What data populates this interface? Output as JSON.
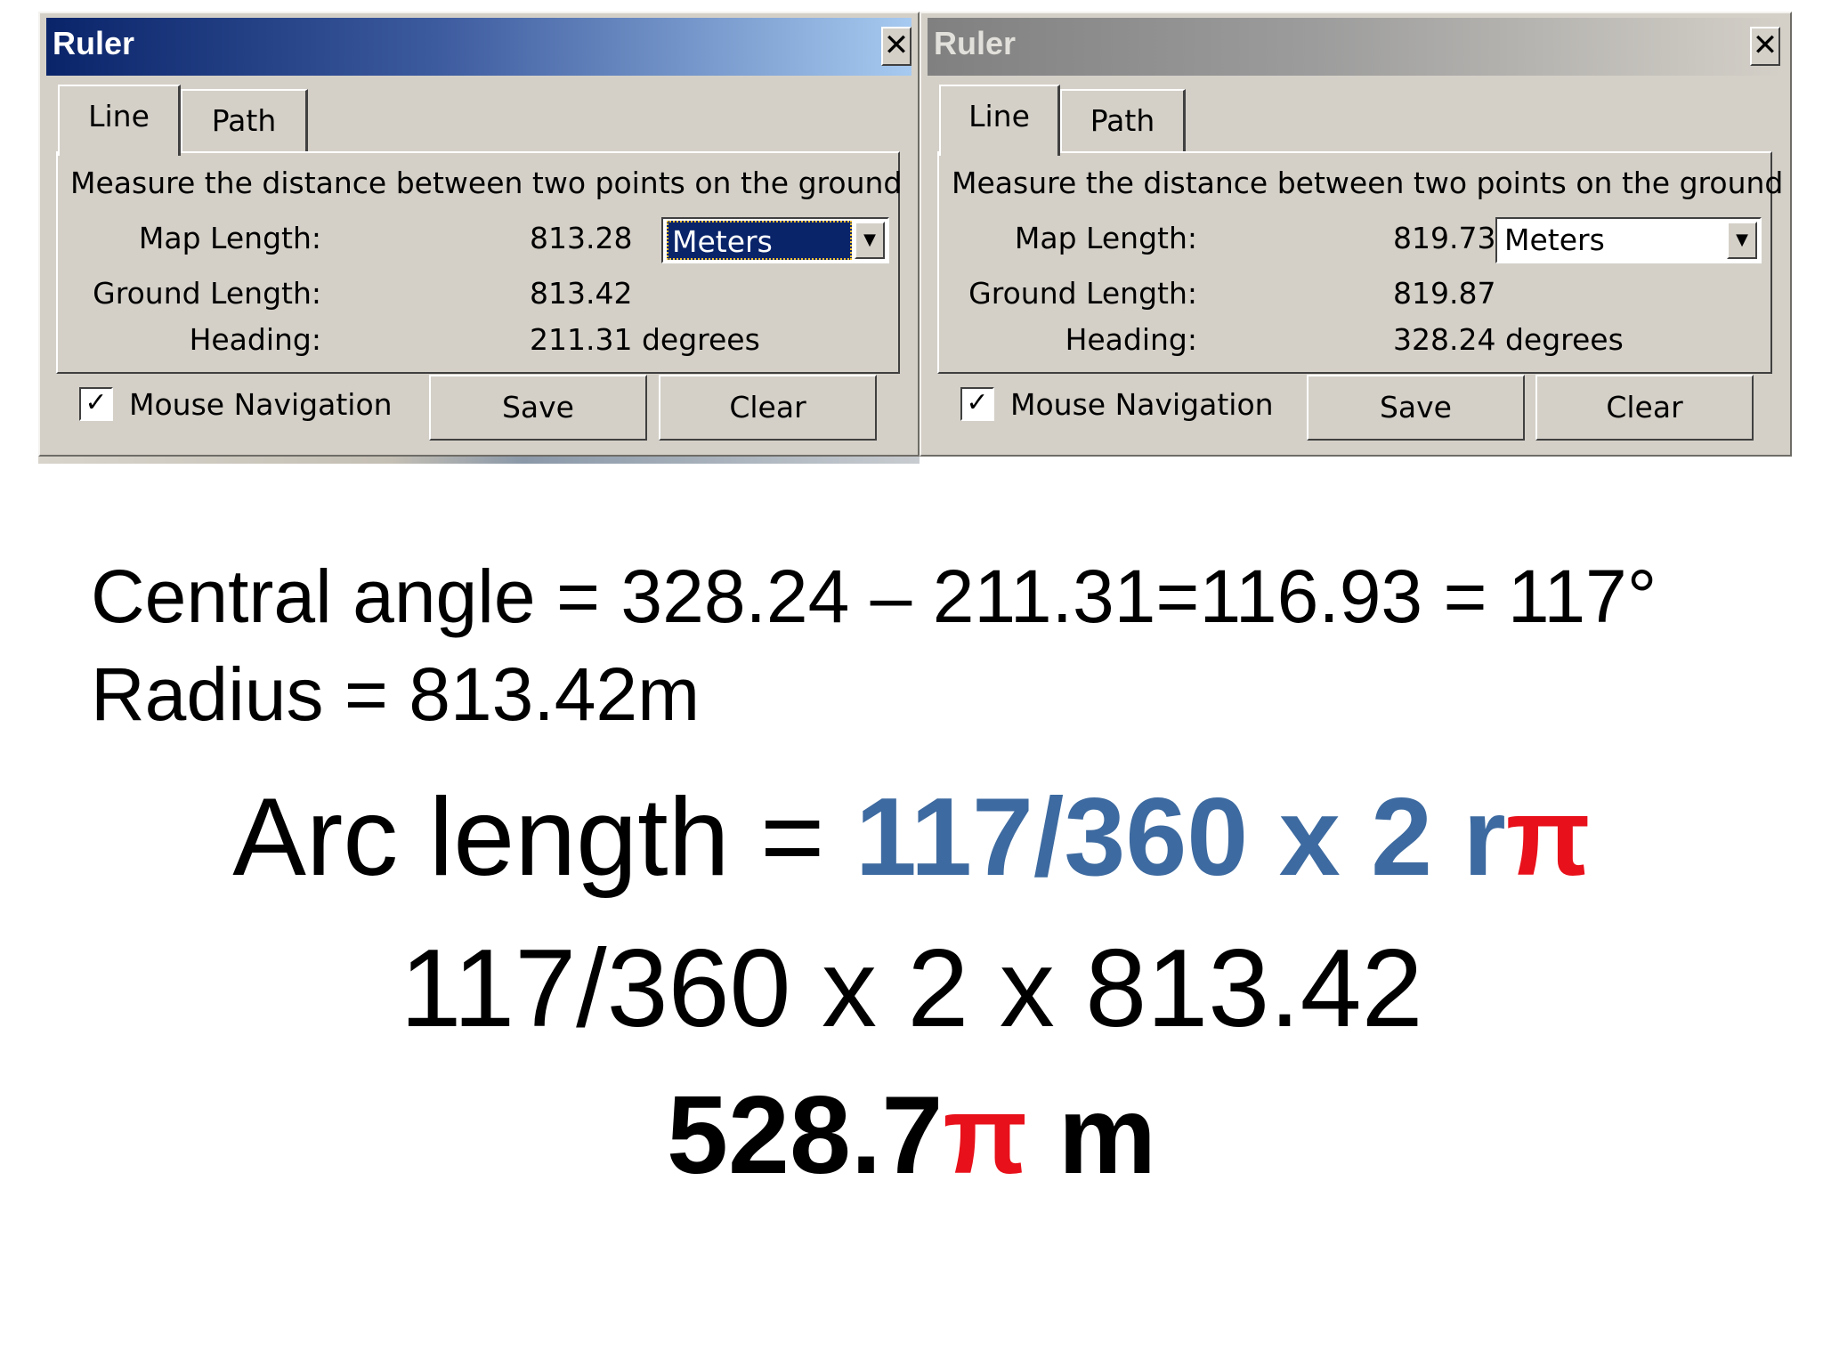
{
  "windows": [
    {
      "title": "Ruler",
      "close_glyph": "✕",
      "tabs": [
        "Line",
        "Path"
      ],
      "description": "Measure the distance between two points on the ground",
      "map_length_label": "Map Length:",
      "map_length_value": "813.28",
      "unit": "Meters",
      "ground_length_label": "Ground Length:",
      "ground_length_value": "813.42",
      "heading_label": "Heading:",
      "heading_value": "211.31 degrees",
      "mouse_nav_label": "Mouse Navigation",
      "mouse_nav_checked_glyph": "✓",
      "save_label": "Save",
      "clear_label": "Clear"
    },
    {
      "title": "Ruler",
      "close_glyph": "✕",
      "tabs": [
        "Line",
        "Path"
      ],
      "description": "Measure the distance between two points on the ground",
      "map_length_label": "Map Length:",
      "map_length_value": "819.73",
      "unit": "Meters",
      "ground_length_label": "Ground Length:",
      "ground_length_value": "819.87",
      "heading_label": "Heading:",
      "heading_value": "328.24 degrees",
      "mouse_nav_label": "Mouse Navigation",
      "mouse_nav_checked_glyph": "✓",
      "save_label": "Save",
      "clear_label": "Clear"
    }
  ],
  "calc": {
    "central_angle": "Central angle = 328.24 – 211.31=116.93 = 117°",
    "radius": "Radius = 813.42m",
    "arc_prefix": "Arc length = ",
    "arc_formula": "117/360 x 2 r",
    "arc_pi": "π",
    "substitution": "117/360 x 2 x 813.42",
    "result_number": "528.7",
    "result_pi": "π",
    "result_unit": " m"
  },
  "colors": {
    "formula_blue": "#3d6aa0",
    "pi_red": "#e8101a",
    "active_title": "#0a246a",
    "inactive_title": "#808080",
    "window_face": "#d4d0c8"
  }
}
